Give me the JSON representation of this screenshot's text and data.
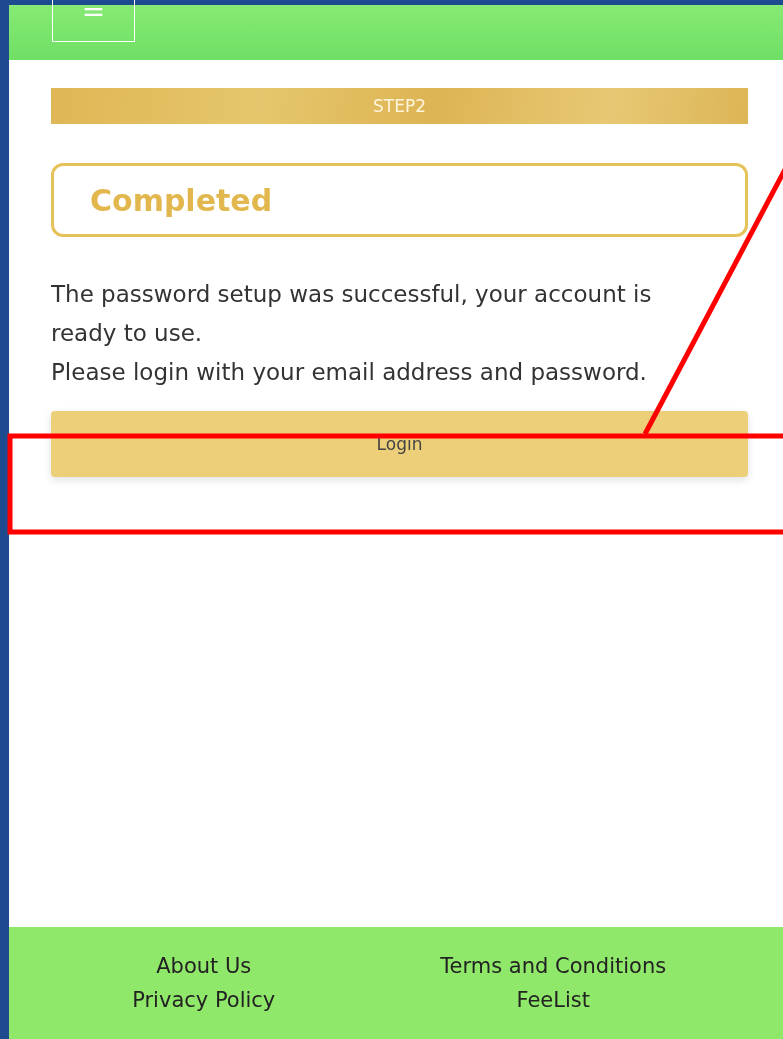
{
  "header": {
    "menu_icon": "="
  },
  "step": {
    "label": "STEP2"
  },
  "status": {
    "label": "Completed"
  },
  "message": [
    "The password setup was successful, your account is ready to use.",
    "Please login with your email address and password."
  ],
  "login_button": {
    "label": "Login"
  },
  "footer": {
    "links": [
      {
        "label": "About Us"
      },
      {
        "label": "Terms and Conditions"
      },
      {
        "label": "Privacy Policy"
      },
      {
        "label": "FeeList"
      }
    ]
  }
}
